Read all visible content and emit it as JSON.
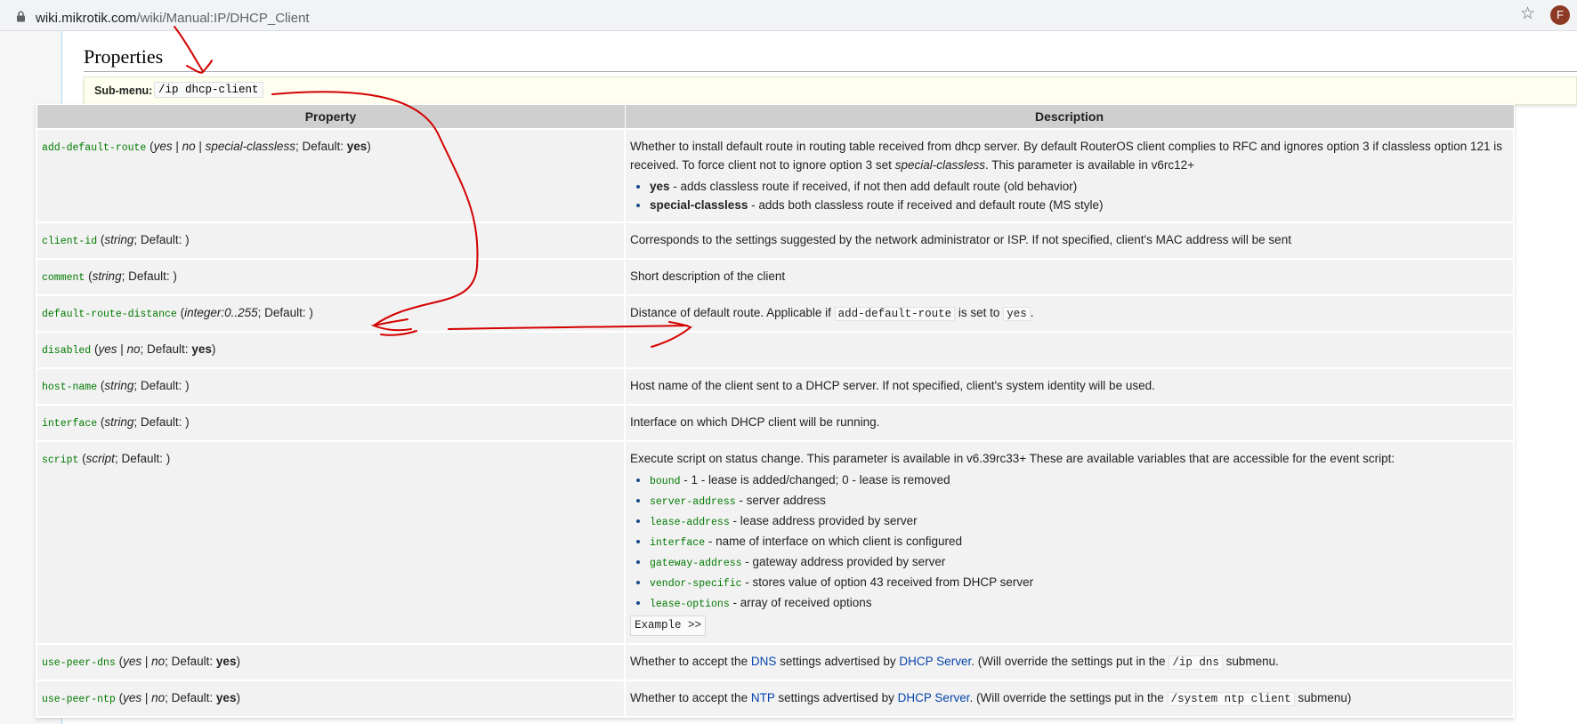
{
  "browser": {
    "url_host": "wiki.mikrotik.com",
    "url_path": "/wiki/Manual:IP/DHCP_Client",
    "avatar_letter": "F",
    "icons": [
      "lock-icon",
      "star-icon"
    ]
  },
  "page": {
    "heading": "Properties",
    "submenu_label": "Sub-menu:",
    "submenu_code": "/ip dhcp-client",
    "table_headers": {
      "property": "Property",
      "description": "Description"
    }
  },
  "rows": [
    {
      "name": "add-default-route",
      "p1": " (",
      "i1": "yes",
      "p2": " | ",
      "i2": "no",
      "p3": " | ",
      "i3": "special-classless",
      "p4": "; Default: ",
      "b1": "yes",
      "p5": ")",
      "desc_a": "Whether to install default route in routing table received from dhcp server. By default RouterOS client complies to RFC and ignores option 3 if classless option 121 is received. To force client not to ignore option 3 set ",
      "desc_i": "special-classless",
      "desc_b": ". This parameter is available in v6rc12+",
      "li1_b": "yes",
      "li1_t": " - adds classless route if received, if not then add default route (old behavior)",
      "li2_b": "special-classless",
      "li2_t": " - adds both classless route if received and default route (MS style)"
    },
    {
      "name": "client-id",
      "p1": " (",
      "i1": "string",
      "p2": "; Default: )",
      "desc": "Corresponds to the settings suggested by the network administrator or ISP. If not specified, client's MAC address will be sent"
    },
    {
      "name": "comment",
      "p1": " (",
      "i1": "string",
      "p2": "; Default: )",
      "desc": "Short description of the client"
    },
    {
      "name": "default-route-distance",
      "p1": " (",
      "i1": "integer:0..255",
      "p2": "; Default: )",
      "desc_a": "Distance of default route. Applicable if ",
      "code1": "add-default-route",
      "desc_b": " is set to ",
      "code2": "yes",
      "desc_c": "."
    },
    {
      "name": "disabled",
      "p1": " (",
      "i1": "yes",
      "p2": " | ",
      "i2": "no",
      "p3": "; Default: ",
      "b1": "yes",
      "p4": ")",
      "desc": ""
    },
    {
      "name": "host-name",
      "p1": " (",
      "i1": "string",
      "p2": "; Default: )",
      "desc": "Host name of the client sent to a DHCP server. If not specified, client's system identity will be used."
    },
    {
      "name": "interface",
      "p1": " (",
      "i1": "string",
      "p2": "; Default: )",
      "desc": "Interface on which DHCP client will be running."
    },
    {
      "name": "script",
      "p1": " (",
      "i1": "script",
      "p2": "; Default: )",
      "desc": "Execute script on status change. This parameter is available in v6.39rc33+ These are available variables that are accessible for the event script:",
      "vars": [
        {
          "code": "bound",
          "text": " - 1 - lease is added/changed; 0 - lease is removed"
        },
        {
          "code": "server-address",
          "text": " - server address"
        },
        {
          "code": "lease-address",
          "text": " - lease address provided by server"
        },
        {
          "code": "interface",
          "text": " - name of interface on which client is configured"
        },
        {
          "code": "gateway-address",
          "text": " - gateway address provided by server"
        },
        {
          "code": "vendor-specific",
          "text": " - stores value of option 43 received from DHCP server"
        },
        {
          "code": "lease-options",
          "text": " - array of received options"
        }
      ],
      "example": "Example >>"
    },
    {
      "name": "use-peer-dns",
      "p1": " (",
      "i1": "yes",
      "p2": " | ",
      "i2": "no",
      "p3": "; Default: ",
      "b1": "yes",
      "p4": ")",
      "desc_a": "Whether to accept the ",
      "link1": "DNS",
      "desc_b": " settings advertised by ",
      "link2": "DHCP Server",
      "desc_c": ". (Will override the settings put in the ",
      "code1": "/ip dns",
      "desc_d": " submenu."
    },
    {
      "name": "use-peer-ntp",
      "p1": " (",
      "i1": "yes",
      "p2": " | ",
      "i2": "no",
      "p3": "; Default: ",
      "b1": "yes",
      "p4": ")",
      "desc_a": "Whether to accept the ",
      "link1": "NTP",
      "desc_b": " settings advertised by ",
      "link2": "DHCP Server",
      "desc_c": ". (Will override the settings put in the ",
      "code1": "/system ntp client",
      "desc_d": " submenu)"
    }
  ],
  "colors": {
    "property_name": "#007a00",
    "link": "#0645ad",
    "annotation": "#d40000"
  }
}
